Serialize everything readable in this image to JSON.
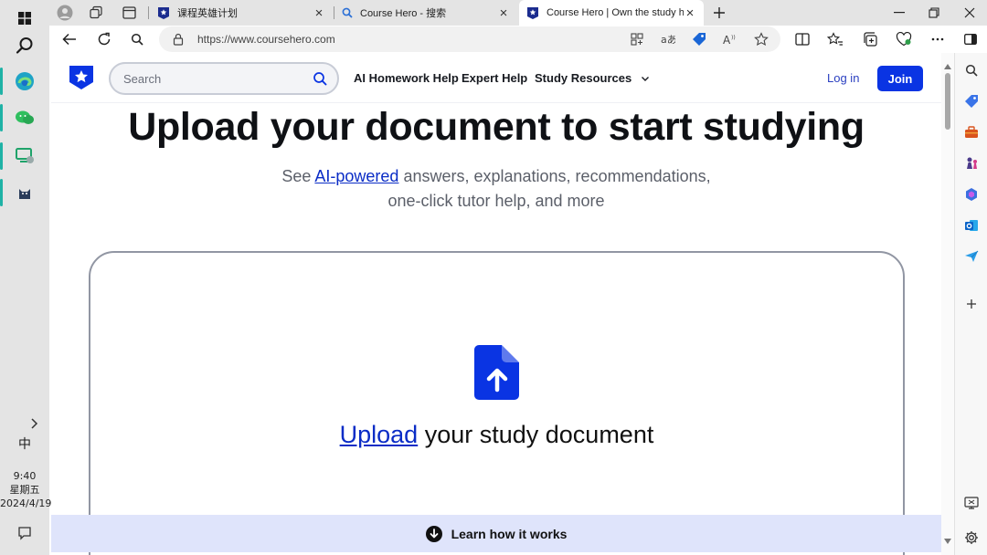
{
  "taskbar": {
    "ime": "中",
    "time": "9:40",
    "weekday": "星期五",
    "date": "2024/4/19"
  },
  "tabs": [
    {
      "title": "课程英雄计划",
      "active": false
    },
    {
      "title": "Course Hero - 搜索",
      "active": false
    },
    {
      "title": "Course Hero | Own the study ho",
      "active": true
    }
  ],
  "address": {
    "url": "https://www.coursehero.com"
  },
  "site": {
    "search_placeholder": "Search",
    "nav": [
      "AI Homework Help",
      "Expert Help",
      "Study Resources"
    ],
    "login": "Log in",
    "join": "Join",
    "brand_color": "#0a34e3"
  },
  "hero": {
    "title": "Upload your document to start studying",
    "sub_prefix": "See ",
    "sub_link": "AI-powered",
    "sub_rest_1": " answers, explanations, recommendations,",
    "sub_rest_2": "one-click tutor help, and more"
  },
  "upload": {
    "link": "Upload",
    "rest": " your study document"
  },
  "learn": {
    "label": "Learn how it works"
  }
}
